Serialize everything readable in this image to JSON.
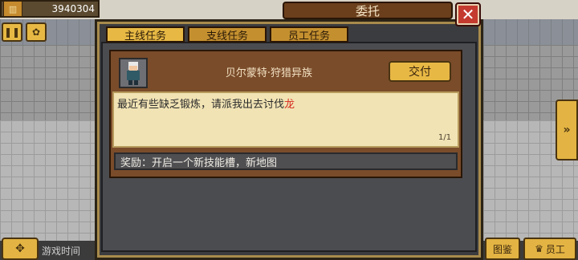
{
  "hud": {
    "money": "3940304",
    "money_icon": "money-bag-icon",
    "game_time_label": "游戏时间"
  },
  "dialog": {
    "title": "委托",
    "close_icon": "close-icon"
  },
  "tabs": [
    {
      "label": "主线任务",
      "active": true
    },
    {
      "label": "支线任务",
      "active": false
    },
    {
      "label": "员工任务",
      "active": false
    }
  ],
  "quest": {
    "title": "贝尔蒙特·狩猎异族",
    "submit_label": "交付",
    "description_prefix": "最近有些缺乏锻炼，请派我出去讨伐",
    "description_highlight": "龙",
    "page_indicator": "1/1",
    "reward": "奖励：开启一个新技能槽，新地图"
  },
  "bottom": {
    "codex_label": "图鉴",
    "staff_label": "员工"
  },
  "colors": {
    "highlight_red": "#d62b1e",
    "button_gold": "#e3b443",
    "panel_brown": "#7a4c2a"
  }
}
